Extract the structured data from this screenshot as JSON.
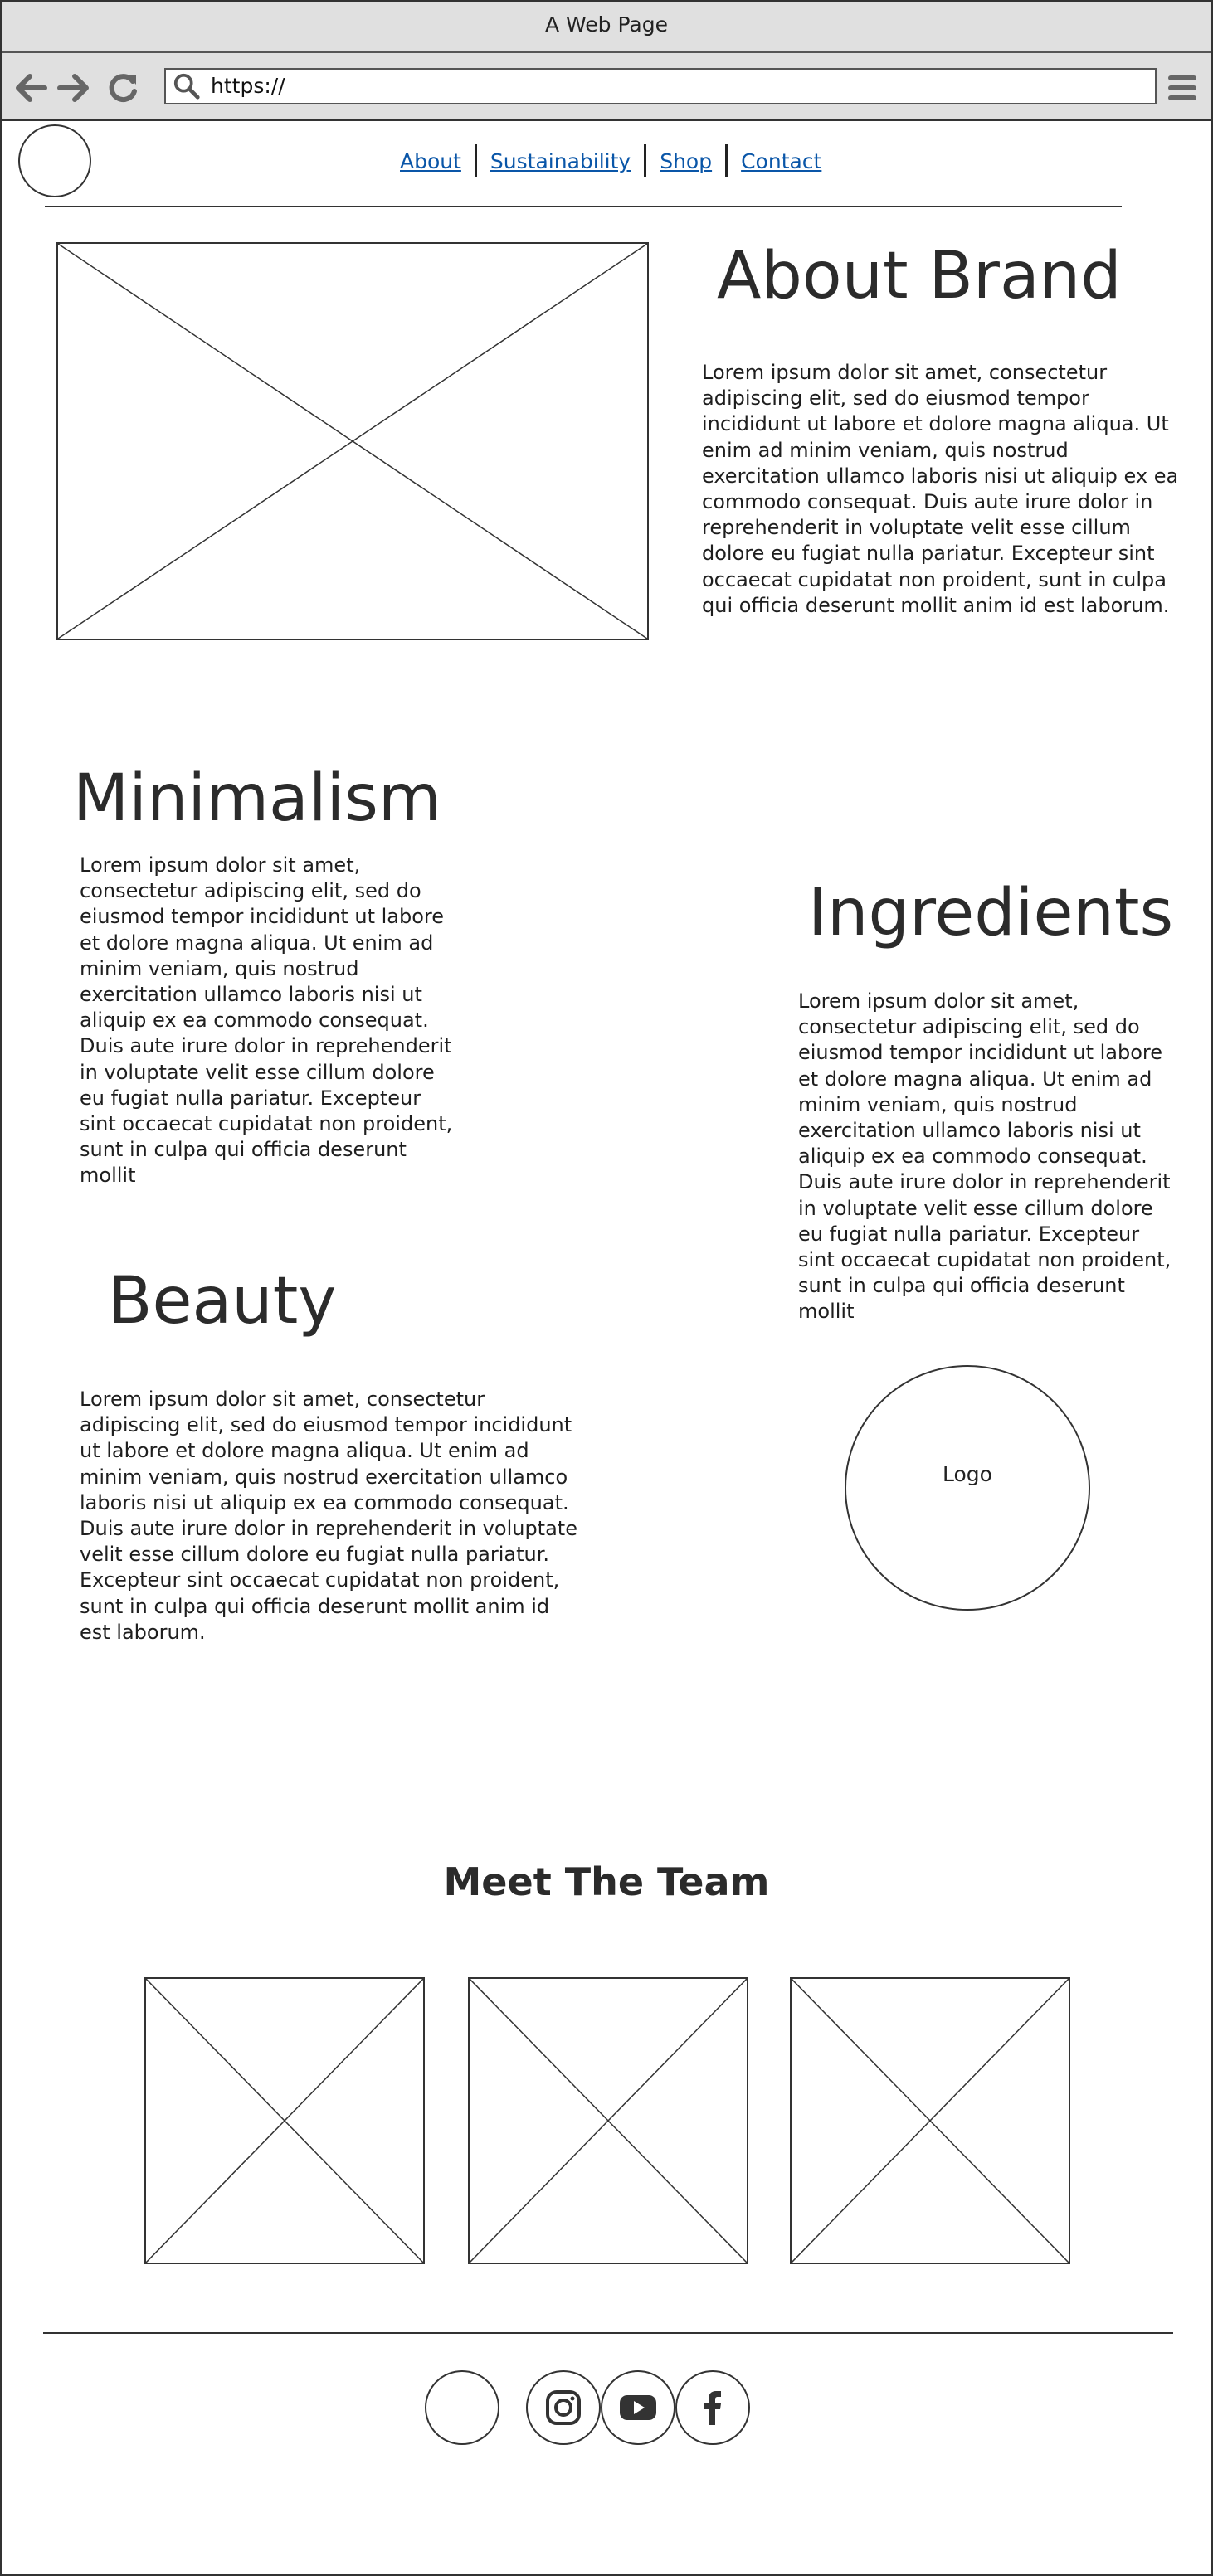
{
  "window": {
    "title": "A Web Page"
  },
  "toolbar": {
    "back_icon": "arrow-left-icon",
    "forward_icon": "arrow-right-icon",
    "reload_icon": "reload-icon",
    "search_icon": "search-icon",
    "url": "https://",
    "menu_icon": "hamburger-menu-icon"
  },
  "nav": {
    "links": [
      {
        "label": "About"
      },
      {
        "label": "Sustainability"
      },
      {
        "label": "Shop"
      },
      {
        "label": "Contact"
      }
    ]
  },
  "about": {
    "title": "About Brand",
    "body": "Lorem ipsum dolor sit amet, consectetur adipiscing elit, sed do eiusmod tempor incididunt ut labore et dolore magna aliqua. Ut enim ad minim veniam, quis nostrud exercitation ullamco laboris nisi ut aliquip ex ea commodo consequat. Duis aute irure dolor in reprehenderit in voluptate velit esse cillum dolore eu fugiat nulla pariatur. Excepteur sint occaecat cupidatat non proident, sunt in culpa qui officia deserunt mollit anim id est laborum."
  },
  "minimalism": {
    "title": "Minimalism",
    "body": "Lorem ipsum dolor sit amet, consectetur adipiscing elit, sed do eiusmod tempor incididunt ut labore et dolore magna aliqua. Ut enim ad minim veniam, quis nostrud exercitation ullamco laboris nisi ut aliquip ex ea commodo consequat. Duis aute irure dolor in reprehenderit in voluptate velit esse cillum dolore eu fugiat nulla pariatur. Excepteur sint occaecat cupidatat non proident, sunt in culpa qui officia deserunt mollit"
  },
  "ingredients": {
    "title": "Ingredients",
    "body": "Lorem ipsum dolor sit amet, consectetur adipiscing elit, sed do eiusmod tempor incididunt ut labore et dolore magna aliqua. Ut enim ad minim veniam, quis nostrud exercitation ullamco laboris nisi ut aliquip ex ea commodo consequat. Duis aute irure dolor in reprehenderit in voluptate velit esse cillum dolore eu fugiat nulla pariatur. Excepteur sint occaecat cupidatat non proident, sunt in culpa qui officia deserunt mollit"
  },
  "beauty": {
    "title": "Beauty",
    "body": "Lorem ipsum dolor sit amet, consectetur adipiscing elit, sed do eiusmod tempor incididunt ut labore et dolore magna aliqua. Ut enim ad minim veniam, quis nostrud exercitation ullamco laboris nisi ut aliquip ex ea commodo consequat. Duis aute irure dolor in reprehenderit in voluptate velit esse cillum dolore eu fugiat nulla pariatur. Excepteur sint occaecat cupidatat non proident, sunt in culpa qui officia deserunt mollit anim id est laborum."
  },
  "logo": {
    "label": "Logo"
  },
  "team": {
    "title": "Meet The Team"
  },
  "footer": {
    "icons": [
      "instagram-icon",
      "youtube-icon",
      "facebook-icon"
    ]
  }
}
